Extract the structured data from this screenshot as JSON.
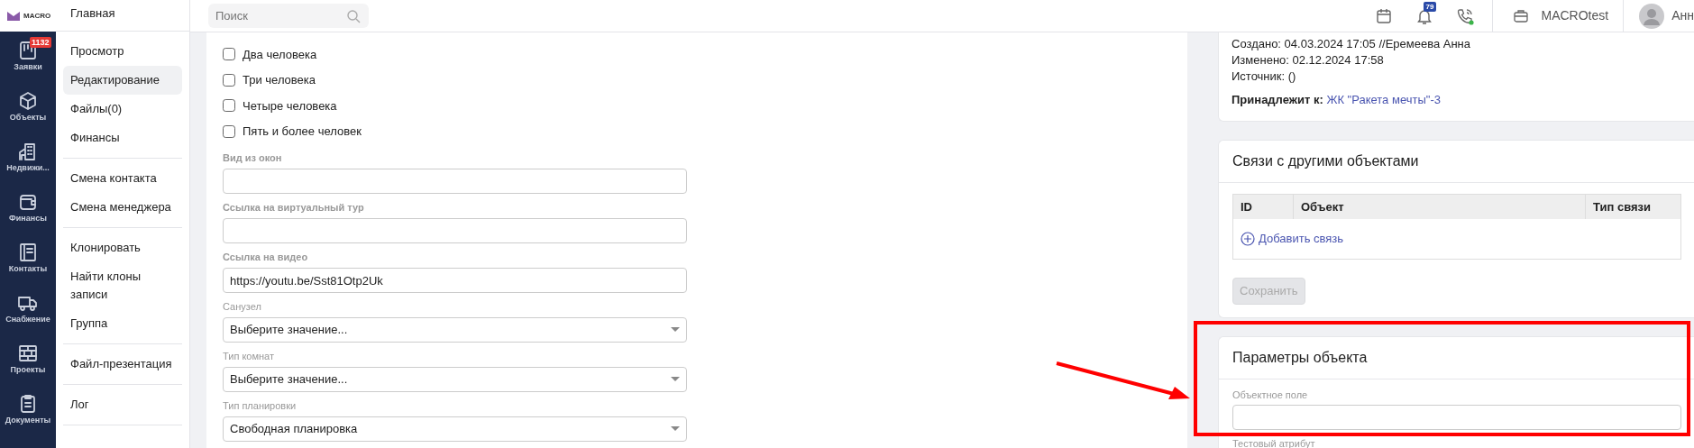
{
  "app_logo": {
    "text": "MACRO"
  },
  "nav_rail": [
    {
      "label": "Заявки",
      "badge": "1132"
    },
    {
      "label": "Объекты"
    },
    {
      "label": "Недвижи..."
    },
    {
      "label": "Финансы"
    },
    {
      "label": "Контакты"
    },
    {
      "label": "Снабжение"
    },
    {
      "label": "Проекты"
    },
    {
      "label": "Документы"
    }
  ],
  "section_menu": {
    "title": "Главная",
    "groups": [
      [
        {
          "label": "Просмотр",
          "selected": false
        },
        {
          "label": "Редактирование",
          "selected": true
        },
        {
          "label": "Файлы(0)",
          "selected": false
        },
        {
          "label": "Финансы",
          "selected": false
        }
      ],
      [
        {
          "label": "Смена контакта",
          "selected": false
        },
        {
          "label": "Смена менеджера",
          "selected": false
        }
      ],
      [
        {
          "label": "Клонировать",
          "selected": false
        },
        {
          "label": "Найти клоны записи",
          "selected": false
        },
        {
          "label": "Группа",
          "selected": false
        }
      ],
      [
        {
          "label": "Файл-презентация",
          "selected": false
        }
      ],
      [
        {
          "label": "Лог",
          "selected": false
        }
      ]
    ]
  },
  "search": {
    "placeholder": "Поиск"
  },
  "header": {
    "notifications": "79",
    "phone_online": true,
    "company": "MACROtest",
    "user": "Анн"
  },
  "form": {
    "checkboxes": [
      {
        "label": "Два человека",
        "checked": false
      },
      {
        "label": "Три человека",
        "checked": false
      },
      {
        "label": "Четыре человека",
        "checked": false
      },
      {
        "label": "Пять и более человек",
        "checked": false
      }
    ],
    "fields": [
      {
        "kind": "text",
        "label": "Вид из окон",
        "bold": true
      },
      {
        "kind": "text",
        "label": "Ссылка на виртуальный тур",
        "bold": true
      },
      {
        "kind": "text",
        "label": "Ссылка на видео",
        "bold": true,
        "value": "https://youtu.be/Sst81Otp2Uk"
      },
      {
        "kind": "select",
        "label": "Санузел",
        "bold": false,
        "value": "Выберите значение..."
      },
      {
        "kind": "select",
        "label": "Тип комнат",
        "bold": false,
        "value": "Выберите значение..."
      },
      {
        "kind": "select",
        "label": "Тип планировки",
        "bold": false,
        "value": "Свободная планировка"
      }
    ]
  },
  "record_info": {
    "lines": [
      "Создано: 04.03.2024 17:05 //Еремеева Анна",
      "Изменено: 02.12.2024 17:58",
      "Источник: ()"
    ],
    "belongs_label": "Принадлежит к:",
    "belongs_link": "ЖК \"Ракета мечты\"-3"
  },
  "links_card": {
    "title": "Связи с другими объектами",
    "columns": [
      "ID",
      "Объект",
      "Тип связи"
    ],
    "add_link": "Добавить связь",
    "save": {
      "label": "Сохранить",
      "disabled": true
    }
  },
  "params_card": {
    "title": "Параметры объекта",
    "fields": [
      {
        "label": "Объектное поле",
        "input": true
      },
      {
        "label": "Тестовый атрибут",
        "input": false
      }
    ]
  }
}
